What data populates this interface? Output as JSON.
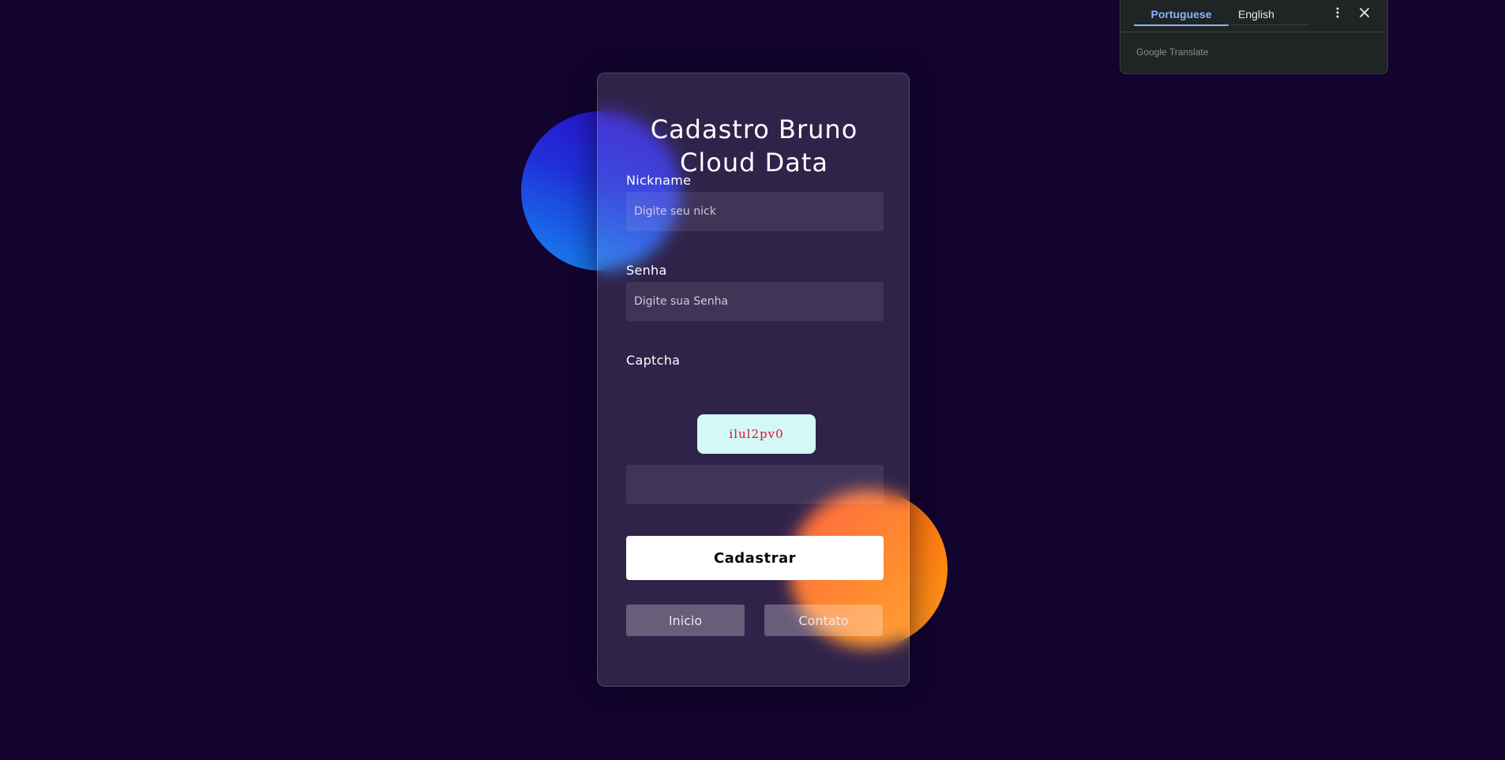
{
  "form": {
    "title_line1": "Cadastro Bruno",
    "title_line2": "Cloud Data",
    "nickname_label": "Nickname",
    "nickname_placeholder": "Digite seu nick",
    "password_label": "Senha",
    "password_placeholder": "Digite sua Senha",
    "captcha_label": "Captcha",
    "captcha_code": "ilul2pv0",
    "captcha_input_value": "",
    "submit_label": "Cadastrar",
    "home_label": "Inicio",
    "contact_label": "Contato"
  },
  "translate_popup": {
    "source_language": "Portuguese",
    "target_language": "English",
    "brand": "Google Translate",
    "more_icon": "more-vertical-icon",
    "close_icon": "close-icon"
  },
  "colors": {
    "background": "#12032f",
    "blob_blue": "#1f2fd9",
    "blob_orange": "#ff7a10",
    "captcha_bg": "#d4f7f7",
    "captcha_text": "#e0101f",
    "translate_accent": "#8ab4f8"
  }
}
